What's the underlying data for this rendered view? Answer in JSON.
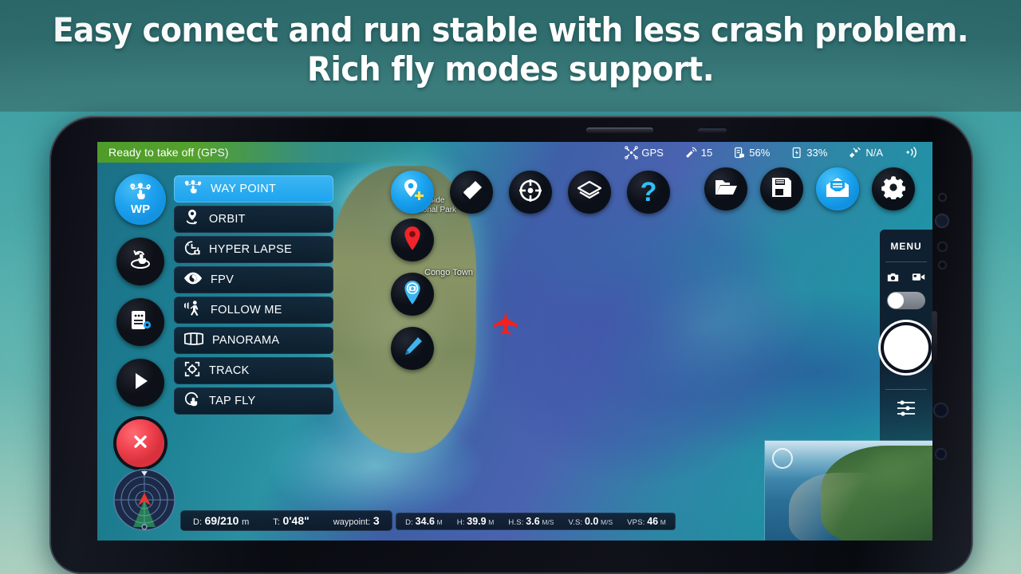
{
  "promo": {
    "headline_line1": "Easy connect and run stable with less crash problem.",
    "headline_line2": "Rich fly modes support."
  },
  "app": {
    "status_bar": {
      "flight_status": "Ready to take off",
      "positioning_mode": "(GPS)",
      "indicators": [
        {
          "icon": "drone-gps-icon",
          "label": "GPS"
        },
        {
          "icon": "satellite-dish-icon",
          "label": "15"
        },
        {
          "icon": "remote-battery-icon",
          "label": "56%"
        },
        {
          "icon": "aircraft-battery-icon",
          "label": "33%"
        },
        {
          "icon": "satellite-signal-icon",
          "label": "N/A"
        },
        {
          "icon": "signal-strength-icon",
          "label": ""
        }
      ]
    },
    "left_rail": [
      {
        "name": "waypoint-mode",
        "icon": "waypoint-icon",
        "label": "WP",
        "active": true
      },
      {
        "name": "orbit-drag-mode",
        "icon": "orbit-hand-icon",
        "label": "",
        "active": false
      },
      {
        "name": "mission-settings",
        "icon": "list-gear-icon",
        "label": "",
        "active": false
      },
      {
        "name": "start-mission",
        "icon": "play-icon",
        "label": "",
        "active": false
      },
      {
        "name": "cancel-mission",
        "icon": "close-x-icon",
        "label": "",
        "active": false
      }
    ],
    "fly_modes": [
      {
        "label": "WAY POINT",
        "icon": "waypoint-icon",
        "active": true
      },
      {
        "label": "ORBIT",
        "icon": "orbit-icon",
        "active": false
      },
      {
        "label": "HYPER LAPSE",
        "icon": "clock-camera-icon",
        "active": false
      },
      {
        "label": "FPV",
        "icon": "eye-icon",
        "active": false
      },
      {
        "label": "FOLLOW ME",
        "icon": "person-walk-icon",
        "active": false
      },
      {
        "label": "PANORAMA",
        "icon": "panorama-icon",
        "active": false
      },
      {
        "label": "TRACK",
        "icon": "track-target-icon",
        "active": false
      },
      {
        "label": "TAP FLY",
        "icon": "tap-hand-icon",
        "active": false
      }
    ],
    "map_tools_row": [
      {
        "name": "add-waypoint-button",
        "icon": "pin-plus-icon",
        "accent": true
      },
      {
        "name": "erase-button",
        "icon": "eraser-icon",
        "accent": false
      },
      {
        "name": "center-target-button",
        "icon": "crosshair-icon",
        "accent": false
      },
      {
        "name": "map-layers-button",
        "icon": "layers-icon",
        "accent": false
      },
      {
        "name": "help-button",
        "icon": "question-mark-icon",
        "accent": false
      }
    ],
    "map_tools_column": [
      {
        "name": "home-point-button",
        "icon": "red-pin-icon"
      },
      {
        "name": "photo-waypoint-button",
        "icon": "camera-pin-icon"
      },
      {
        "name": "edit-route-button",
        "icon": "pencil-icon"
      }
    ],
    "right_tools": [
      {
        "name": "open-mission-button",
        "icon": "folder-icon",
        "accent": false
      },
      {
        "name": "save-mission-button",
        "icon": "floppy-disk-icon",
        "accent": false
      },
      {
        "name": "messages-button",
        "icon": "envelope-icon",
        "accent": true
      },
      {
        "name": "settings-button",
        "icon": "gear-icon",
        "accent": false
      }
    ],
    "camera_panel": {
      "menu_label": "MENU",
      "photo_icon": "camera-icon",
      "video_icon": "video-camera-icon",
      "toggle_position": "photo",
      "shutter_label": "",
      "sliders_icon": "sliders-icon"
    },
    "map": {
      "labels": [
        {
          "text": "West Side",
          "sub": "National Park"
        },
        {
          "text": "Congo Town"
        }
      ],
      "aircraft_marker": "aircraft-icon"
    },
    "telemetry": {
      "primary": [
        {
          "key": "D:",
          "value": "69/210",
          "unit": "m"
        },
        {
          "key": "T:",
          "value": "0'48\"",
          "unit": ""
        },
        {
          "key": "waypoint:",
          "value": "3",
          "unit": ""
        }
      ],
      "secondary": [
        {
          "key": "D:",
          "value": "34.6",
          "unit": "M"
        },
        {
          "key": "H:",
          "value": "39.9",
          "unit": "M"
        },
        {
          "key": "H.S:",
          "value": "3.6",
          "unit": "M/S"
        },
        {
          "key": "V.S:",
          "value": "0.0",
          "unit": "M/S"
        },
        {
          "key": "VPS:",
          "value": "46",
          "unit": "M"
        }
      ]
    },
    "radar": {
      "icon": "radar-attitude-icon"
    },
    "pip": {
      "icon": "live-preview-thumbnail"
    }
  },
  "colors": {
    "accent": "#1aa3ef",
    "status_green": "#53a22c",
    "danger": "#f0434f",
    "panel": "#0d1420"
  }
}
